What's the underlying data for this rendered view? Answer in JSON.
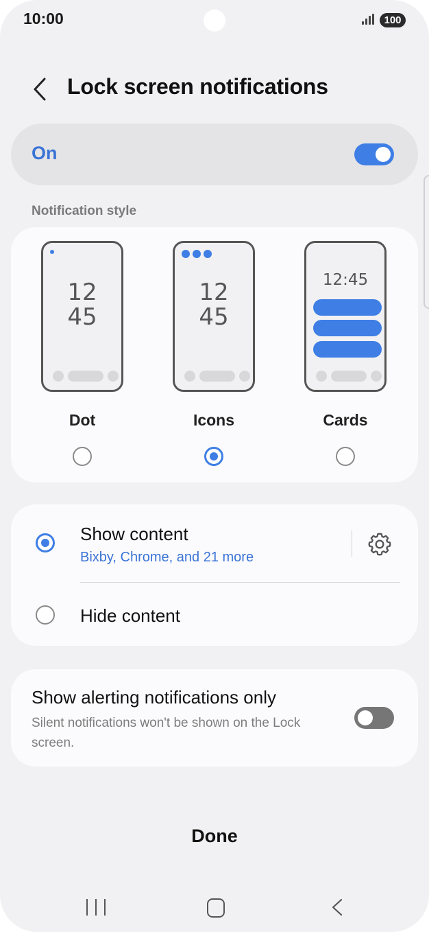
{
  "status_bar": {
    "time": "10:00",
    "battery": "100",
    "icons": [
      "signal-icon",
      "battery-icon"
    ]
  },
  "header": {
    "title": "Lock screen notifications",
    "back_icon": "chevron-left-icon"
  },
  "master_switch": {
    "label": "On",
    "enabled": true
  },
  "notification_style": {
    "section_label": "Notification style",
    "options": [
      {
        "label": "Dot",
        "selected": false,
        "preview_time": [
          "12",
          "45"
        ]
      },
      {
        "label": "Icons",
        "selected": true,
        "preview_time": [
          "12",
          "45"
        ]
      },
      {
        "label": "Cards",
        "selected": false,
        "preview_time": [
          "12:45"
        ]
      }
    ]
  },
  "content": {
    "show": {
      "title": "Show content",
      "subtitle": "Bixby, Chrome, and 21 more",
      "selected": true,
      "settings_icon": "gear-icon"
    },
    "hide": {
      "title": "Hide content",
      "selected": false
    }
  },
  "alerting": {
    "title": "Show alerting notifications only",
    "subtitle": "Silent notifications won't be shown on the Lock screen.",
    "enabled": false
  },
  "footer": {
    "done_label": "Done"
  },
  "navigation": {
    "icons": [
      "recent-apps-icon",
      "home-icon",
      "back-icon"
    ]
  },
  "colors": {
    "accent": "#3e7ee5",
    "background": "#f1f1f3",
    "card": "#fbfbfd"
  }
}
